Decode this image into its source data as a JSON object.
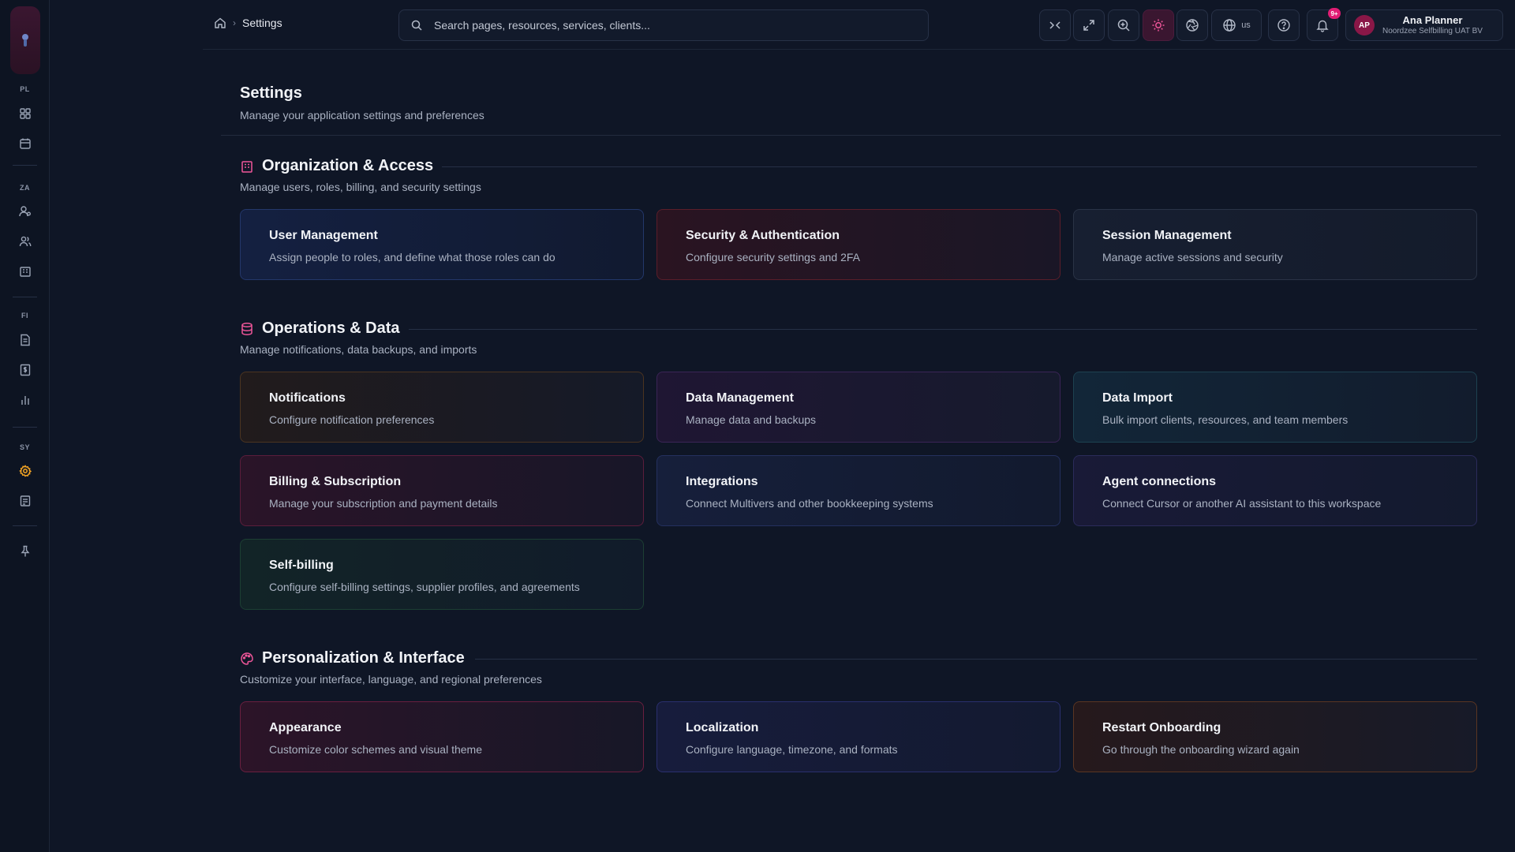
{
  "rail": {
    "sections": [
      "PL",
      "ZA",
      "FI",
      "SY"
    ]
  },
  "breadcrumb": {
    "current": "Settings"
  },
  "search": {
    "placeholder": "Search pages, resources, services, clients..."
  },
  "topbar": {
    "language": "us",
    "notification_badge": "9+"
  },
  "user": {
    "initials": "AP",
    "name": "Ana Planner",
    "organization": "Noordzee Selfbilling UAT BV"
  },
  "page": {
    "title": "Settings",
    "subtitle": "Manage your application settings and preferences"
  },
  "sections": [
    {
      "title": "Organization & Access",
      "subtitle": "Manage users, roles, billing, and security settings",
      "cards": [
        {
          "title": "User Management",
          "description": "Assign people to roles, and define what those roles can do"
        },
        {
          "title": "Security & Authentication",
          "description": "Configure security settings and 2FA"
        },
        {
          "title": "Session Management",
          "description": "Manage active sessions and security"
        }
      ]
    },
    {
      "title": "Operations & Data",
      "subtitle": "Manage notifications, data backups, and imports",
      "cards": [
        {
          "title": "Notifications",
          "description": "Configure notification preferences"
        },
        {
          "title": "Data Management",
          "description": "Manage data and backups"
        },
        {
          "title": "Data Import",
          "description": "Bulk import clients, resources, and team members"
        },
        {
          "title": "Billing & Subscription",
          "description": "Manage your subscription and payment details"
        },
        {
          "title": "Integrations",
          "description": "Connect Multivers and other bookkeeping systems"
        },
        {
          "title": "Agent connections",
          "description": "Connect Cursor or another AI assistant to this workspace"
        },
        {
          "title": "Self-billing",
          "description": "Configure self-billing settings, supplier profiles, and agreements"
        }
      ]
    },
    {
      "title": "Personalization & Interface",
      "subtitle": "Customize your interface, language, and regional preferences",
      "cards": [
        {
          "title": "Appearance",
          "description": "Customize color schemes and visual theme"
        },
        {
          "title": "Localization",
          "description": "Configure language, timezone, and formats"
        },
        {
          "title": "Restart Onboarding",
          "description": "Go through the onboarding wizard again"
        }
      ]
    }
  ],
  "colors": {
    "accent": "#e11d74",
    "section_icon": "#f0569a",
    "active_rail_icon": "#f5a524"
  }
}
